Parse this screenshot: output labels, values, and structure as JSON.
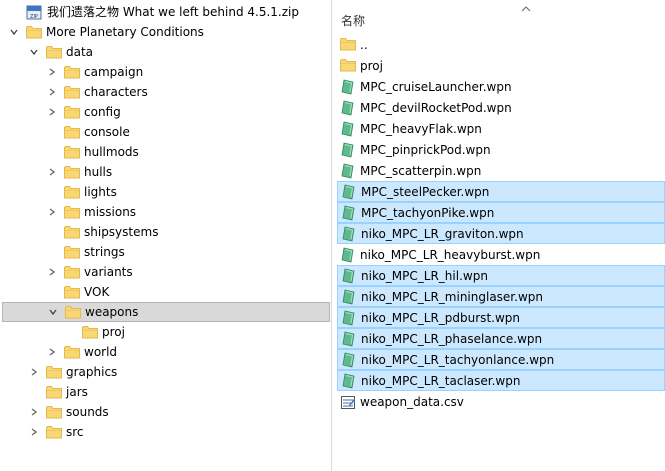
{
  "tree": {
    "items": [
      {
        "label": "我们遗落之物 What we left behind 4.5.1.zip",
        "icon": "zip-archive-icon",
        "chevron": "none",
        "depth": 0,
        "selected": false
      },
      {
        "label": "More Planetary Conditions",
        "icon": "folder-icon",
        "chevron": "expanded",
        "depth": 0,
        "selected": false
      },
      {
        "label": "data",
        "icon": "folder-icon",
        "chevron": "expanded",
        "depth": 1,
        "selected": false
      },
      {
        "label": "campaign",
        "icon": "folder-icon",
        "chevron": "collapsed",
        "depth": 2,
        "selected": false
      },
      {
        "label": "characters",
        "icon": "folder-icon",
        "chevron": "collapsed",
        "depth": 2,
        "selected": false
      },
      {
        "label": "config",
        "icon": "folder-icon",
        "chevron": "collapsed",
        "depth": 2,
        "selected": false
      },
      {
        "label": "console",
        "icon": "folder-icon",
        "chevron": "none",
        "depth": 2,
        "selected": false
      },
      {
        "label": "hullmods",
        "icon": "folder-icon",
        "chevron": "none",
        "depth": 2,
        "selected": false
      },
      {
        "label": "hulls",
        "icon": "folder-icon",
        "chevron": "collapsed",
        "depth": 2,
        "selected": false
      },
      {
        "label": "lights",
        "icon": "folder-icon",
        "chevron": "none",
        "depth": 2,
        "selected": false
      },
      {
        "label": "missions",
        "icon": "folder-icon",
        "chevron": "collapsed",
        "depth": 2,
        "selected": false
      },
      {
        "label": "shipsystems",
        "icon": "folder-icon",
        "chevron": "none",
        "depth": 2,
        "selected": false
      },
      {
        "label": "strings",
        "icon": "folder-icon",
        "chevron": "none",
        "depth": 2,
        "selected": false
      },
      {
        "label": "variants",
        "icon": "folder-icon",
        "chevron": "collapsed",
        "depth": 2,
        "selected": false
      },
      {
        "label": "VOK",
        "icon": "folder-icon",
        "chevron": "none",
        "depth": 2,
        "selected": false
      },
      {
        "label": "weapons",
        "icon": "folder-icon",
        "chevron": "expanded",
        "depth": 2,
        "selected": true
      },
      {
        "label": "proj",
        "icon": "folder-icon",
        "chevron": "none",
        "depth": 3,
        "selected": false
      },
      {
        "label": "world",
        "icon": "folder-icon",
        "chevron": "collapsed",
        "depth": 2,
        "selected": false
      },
      {
        "label": "graphics",
        "icon": "folder-icon",
        "chevron": "collapsed",
        "depth": 1,
        "selected": false
      },
      {
        "label": "jars",
        "icon": "folder-icon",
        "chevron": "none",
        "depth": 1,
        "selected": false
      },
      {
        "label": "sounds",
        "icon": "folder-icon",
        "chevron": "collapsed",
        "depth": 1,
        "selected": false
      },
      {
        "label": "src",
        "icon": "folder-icon",
        "chevron": "collapsed",
        "depth": 1,
        "selected": false
      }
    ]
  },
  "list": {
    "column_name": "名称",
    "sort": "ascending",
    "items": [
      {
        "label": "..",
        "icon": "folder-icon",
        "selected": false
      },
      {
        "label": "proj",
        "icon": "folder-icon",
        "selected": false
      },
      {
        "label": "MPC_cruiseLauncher.wpn",
        "icon": "wpn-file-icon",
        "selected": false
      },
      {
        "label": "MPC_devilRocketPod.wpn",
        "icon": "wpn-file-icon",
        "selected": false
      },
      {
        "label": "MPC_heavyFlak.wpn",
        "icon": "wpn-file-icon",
        "selected": false
      },
      {
        "label": "MPC_pinprickPod.wpn",
        "icon": "wpn-file-icon",
        "selected": false
      },
      {
        "label": "MPC_scatterpin.wpn",
        "icon": "wpn-file-icon",
        "selected": false
      },
      {
        "label": "MPC_steelPecker.wpn",
        "icon": "wpn-file-icon",
        "selected": true
      },
      {
        "label": "MPC_tachyonPike.wpn",
        "icon": "wpn-file-icon",
        "selected": true
      },
      {
        "label": "niko_MPC_LR_graviton.wpn",
        "icon": "wpn-file-icon",
        "selected": true
      },
      {
        "label": "niko_MPC_LR_heavyburst.wpn",
        "icon": "wpn-file-icon",
        "selected": false
      },
      {
        "label": "niko_MPC_LR_hil.wpn",
        "icon": "wpn-file-icon",
        "selected": true
      },
      {
        "label": "niko_MPC_LR_mininglaser.wpn",
        "icon": "wpn-file-icon",
        "selected": true
      },
      {
        "label": "niko_MPC_LR_pdburst.wpn",
        "icon": "wpn-file-icon",
        "selected": true
      },
      {
        "label": "niko_MPC_LR_phaselance.wpn",
        "icon": "wpn-file-icon",
        "selected": true
      },
      {
        "label": "niko_MPC_LR_tachyonlance.wpn",
        "icon": "wpn-file-icon",
        "selected": true
      },
      {
        "label": "niko_MPC_LR_taclaser.wpn",
        "icon": "wpn-file-icon",
        "selected": true
      },
      {
        "label": "weapon_data.csv",
        "icon": "csv-file-icon",
        "selected": false
      }
    ]
  },
  "colors": {
    "folder": "#f8d775",
    "folder_dark": "#e6b84c",
    "selection_blue": "#cce8ff",
    "selection_blue_border": "#99d1ff",
    "tree_selection": "#d9d9d9",
    "wpn_icon": "#5fb98c"
  }
}
